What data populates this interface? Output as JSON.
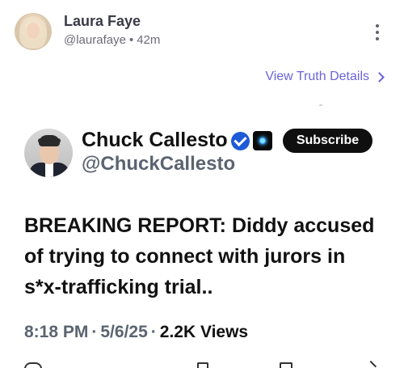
{
  "post": {
    "author_name": "Laura Faye",
    "author_handle": "@laurafaye",
    "separator": "•",
    "timestamp": "42m",
    "details_link": "View Truth Details"
  },
  "embed": {
    "name": "Chuck Callesto",
    "handle": "@ChuckCallesto",
    "subscribe_label": "Subscribe",
    "headline": "BREAKING REPORT: Diddy accused of trying to connect with jurors in s*x-trafficking trial..",
    "time": "8:18 PM",
    "date": "5/6/25",
    "separator": "·",
    "views": "2.2K Views"
  },
  "icons": {
    "menu": "more-vertical-icon",
    "details_chevron": "chevron-right-icon",
    "verified": "verified-badge-icon",
    "brand_badge": "ai-chip-icon"
  },
  "colors": {
    "link": "#6c63d9",
    "verified": "#1d5ad8",
    "button": "#0f0f0f"
  }
}
